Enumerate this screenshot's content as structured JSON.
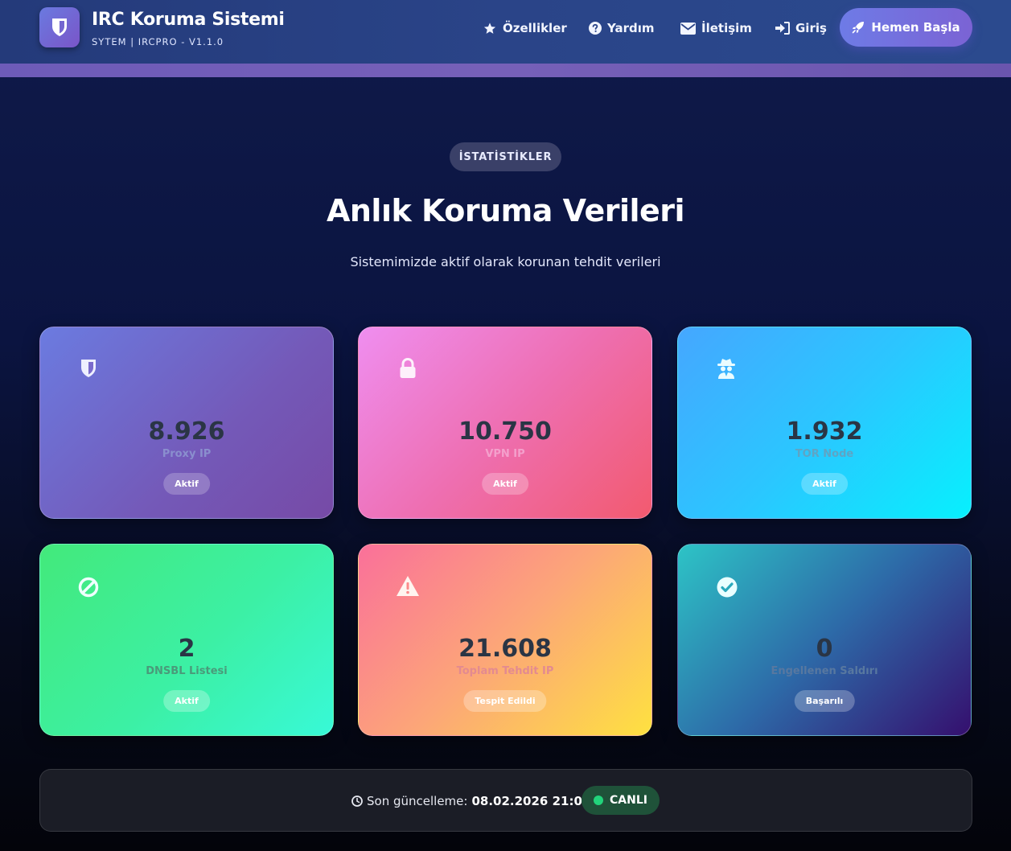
{
  "brand": {
    "title": "IRC Koruma Sistemi",
    "subtitle": "SYTEM | IRCPRO - V1.1.0",
    "logo_icon": "shield-icon"
  },
  "nav": {
    "items": [
      {
        "label": "Özellikler",
        "icon": "star-icon"
      },
      {
        "label": "Yardım",
        "icon": "question-circle-icon"
      },
      {
        "label": "İletişim",
        "icon": "envelope-icon"
      },
      {
        "label": "Giriş",
        "icon": "sign-in-icon"
      }
    ],
    "cta": {
      "label": "Hemen Başla",
      "icon": "rocket-icon"
    }
  },
  "header": {
    "pill": "İSTATİSTİKLER",
    "title": "Anlık Koruma Verileri",
    "subtitle": "Sistemimizde aktif olarak korunan tehdit verileri"
  },
  "stats": [
    {
      "value": "8.926",
      "label": "Proxy IP",
      "badge": "Aktif",
      "icon": "shield-icon"
    },
    {
      "value": "10.750",
      "label": "VPN IP",
      "badge": "Aktif",
      "icon": "lock-icon"
    },
    {
      "value": "1.932",
      "label": "TOR Node",
      "badge": "Aktif",
      "icon": "spy-icon"
    },
    {
      "value": "2",
      "label": "DNSBL Listesi",
      "badge": "Aktif",
      "icon": "ban-icon"
    },
    {
      "value": "21.608",
      "label": "Toplam Tehdit IP",
      "badge": "Tespit Edildi",
      "icon": "warning-icon"
    },
    {
      "value": "0",
      "label": "Engellenen Saldırı",
      "badge": "Başarılı",
      "icon": "check-circle-icon"
    }
  ],
  "status": {
    "update_label": "Son güncelleme:",
    "update_time": "08.02.2026 21:02",
    "live_label": "CANLI",
    "icon": "clock-icon"
  },
  "colors": {
    "accent": "#6e7be6",
    "live_dot": "#22d47b",
    "live_bg": "#1f5239"
  }
}
